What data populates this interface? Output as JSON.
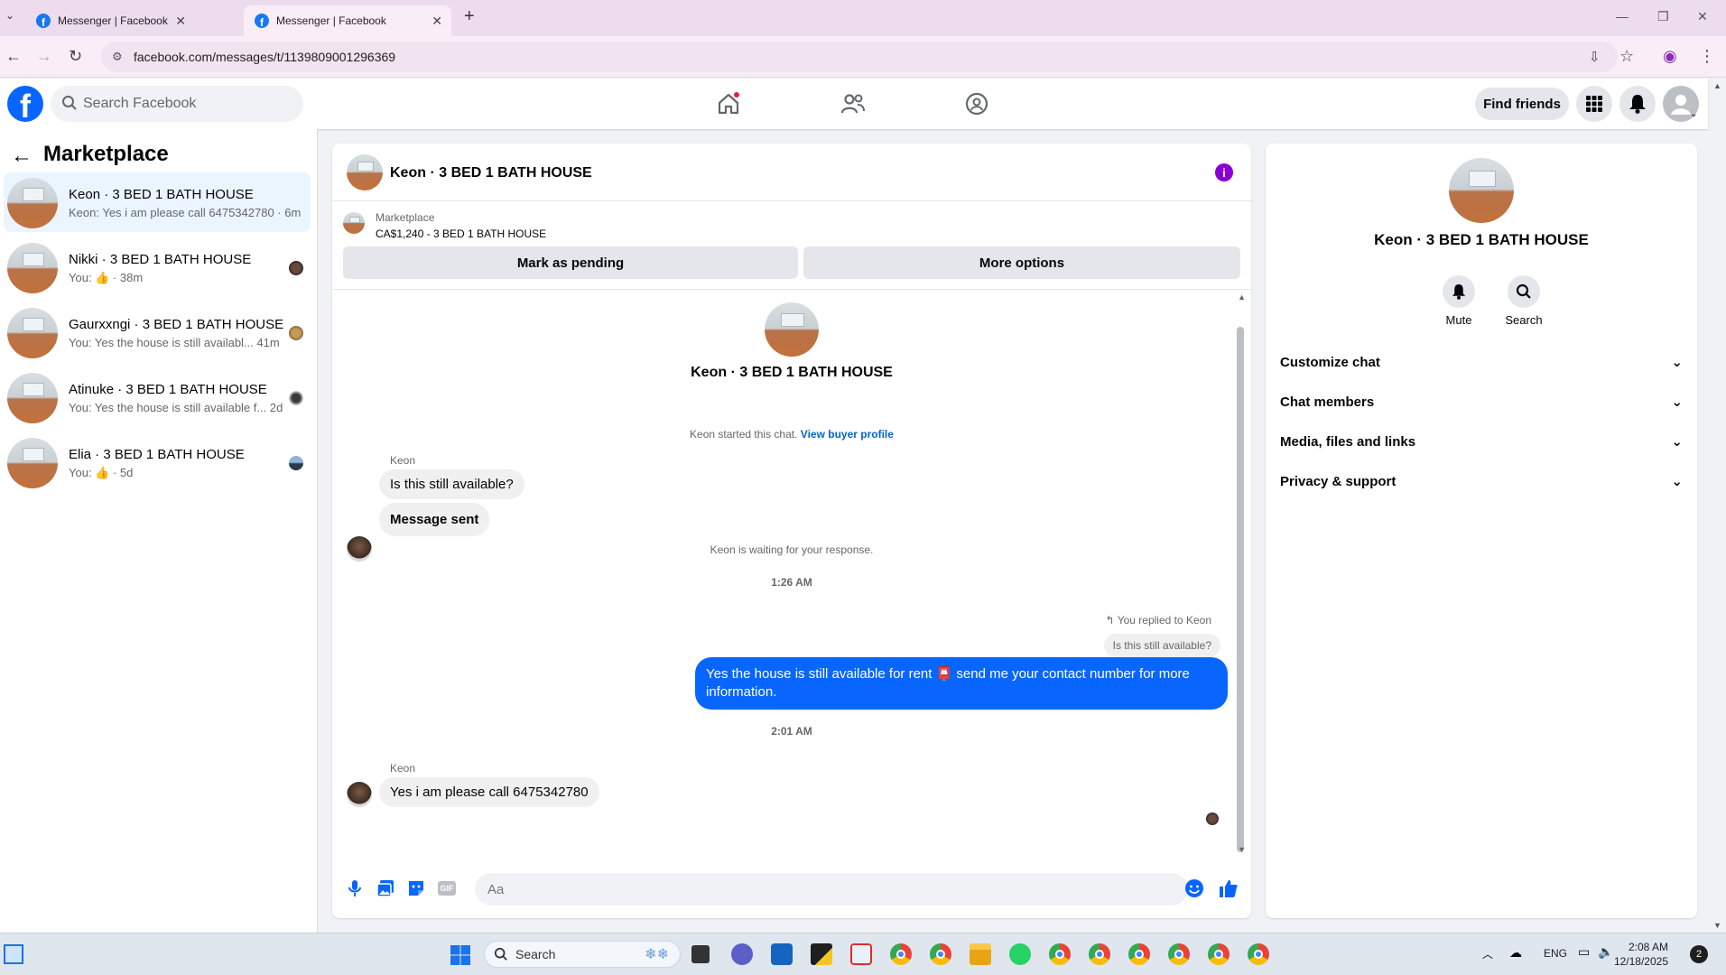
{
  "browser": {
    "tabs": [
      {
        "title": "Messenger | Facebook",
        "active": false
      },
      {
        "title": "Messenger | Facebook",
        "active": true
      }
    ],
    "new_tab": "+",
    "url": "facebook.com/messages/t/1139809001296369"
  },
  "fb": {
    "logo": "f",
    "search_placeholder": "Search Facebook",
    "find_friends": "Find friends"
  },
  "sidebar": {
    "title": "Marketplace",
    "conversations": [
      {
        "name": "Keon · 3 BED 1 BATH HOUSE",
        "preview": "Keon: Yes i am please call 6475342780 · 6m",
        "selected": true
      },
      {
        "name": "Nikki · 3 BED 1 BATH HOUSE",
        "preview": "You: 👍 · 38m",
        "selected": false
      },
      {
        "name": "Gaurxxngi · 3 BED 1 BATH HOUSE",
        "preview": "You: Yes the house is still availabl...  41m",
        "selected": false
      },
      {
        "name": "Atinuke · 3 BED 1 BATH HOUSE",
        "preview": "You: Yes the house is still available f...  2d",
        "selected": false
      },
      {
        "name": "Elia · 3 BED 1 BATH HOUSE",
        "preview": "You: 👍 · 5d",
        "selected": false
      }
    ]
  },
  "chat": {
    "title": "Keon · 3 BED 1 BATH HOUSE",
    "info": "i",
    "listing_label": "Marketplace",
    "listing_price": "CA$1,240 - 3 BED 1 BATH HOUSE",
    "mark_pending": "Mark as pending",
    "more_options": "More options",
    "header_name": "Keon · 3 BED 1 BATH HOUSE",
    "started_text": "Keon started this chat.",
    "view_buyer": "View buyer profile",
    "sender1": "Keon",
    "msg1": "Is this still available?",
    "msg2": "Message sent",
    "waiting": "Keon is waiting for your response.",
    "time1": "1:26 AM",
    "replied_to": "You replied to Keon",
    "reply_quote": "Is this still available?",
    "outgoing": "Yes the house is still available for rent 📮 send me your contact number for more information.",
    "time2": "2:01 AM",
    "sender2": "Keon",
    "msg3": "Yes i am please call 6475342780",
    "input_placeholder": "Aa"
  },
  "details": {
    "name": "Keon · 3 BED 1 BATH HOUSE",
    "mute": "Mute",
    "search": "Search",
    "sections": [
      "Customize chat",
      "Chat members",
      "Media, files and links",
      "Privacy & support"
    ]
  },
  "taskbar": {
    "search": "Search",
    "lang": "ENG",
    "time": "2:08 AM",
    "date": "12/18/2025",
    "badge": "2"
  },
  "colors": {
    "fb_blue": "#0866ff",
    "bubble_out": "#0866ff",
    "info_purple": "#8a00d4",
    "selected_row": "#ebf5ff"
  }
}
